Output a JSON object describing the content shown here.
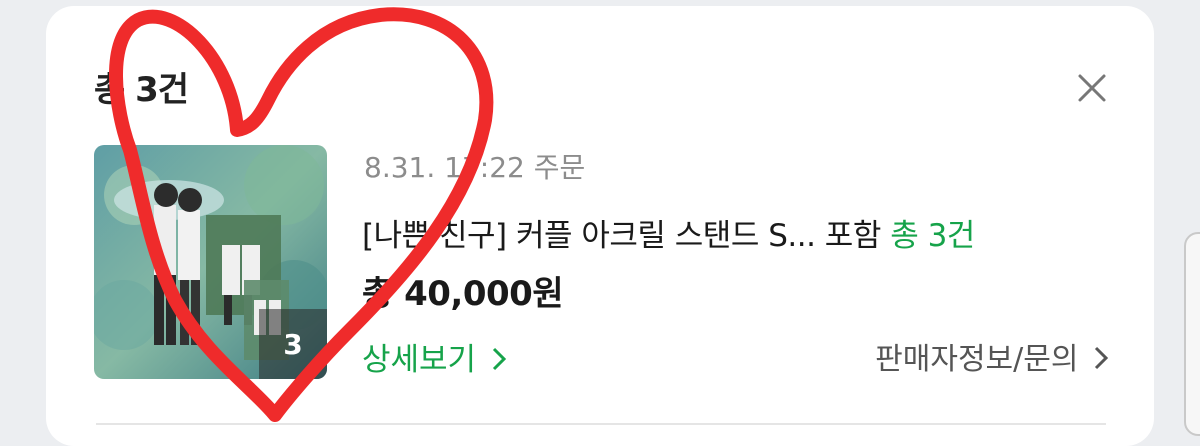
{
  "summary": {
    "title": "총 3건"
  },
  "order": {
    "date": "8.31. 17:22 주문",
    "product_name": "[나쁜 친구] 커플 아크릴 스탠드 S...",
    "include_label": "포함",
    "count_label": "총 3건",
    "total_price": "총 40,000원",
    "item_count": "3",
    "detail_link": "상세보기",
    "seller_link": "판매자정보/문의"
  },
  "colors": {
    "accent_green": "#16a34a",
    "heart_red": "#ef2b2b"
  },
  "icons": {
    "close": "close-icon",
    "chevron": "chevron-right-icon"
  }
}
